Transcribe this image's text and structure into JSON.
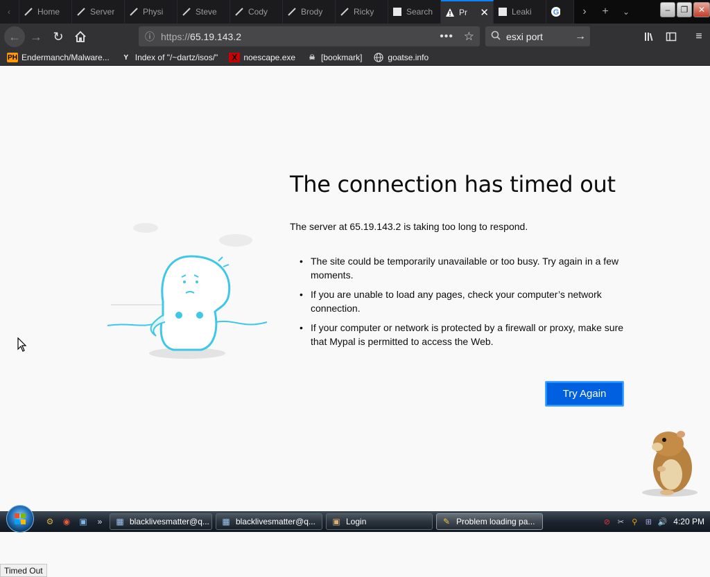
{
  "tabs": [
    {
      "title": "",
      "icon": "nav-back-icon"
    },
    {
      "title": "Home",
      "icon": "pencil-icon"
    },
    {
      "title": "Server",
      "icon": "pencil-icon"
    },
    {
      "title": "Physi",
      "icon": "pencil-icon"
    },
    {
      "title": "Steve",
      "icon": "pencil-icon"
    },
    {
      "title": "Cody",
      "icon": "pencil-icon"
    },
    {
      "title": "Brody",
      "icon": "pencil-icon"
    },
    {
      "title": "Ricky",
      "icon": "pencil-icon"
    },
    {
      "title": "Search",
      "icon": "doc-icon"
    },
    {
      "title": "Pr",
      "icon": "warning-icon",
      "active": true
    },
    {
      "title": "Leaki",
      "icon": "doc-icon"
    },
    {
      "title": "",
      "icon": "google-icon"
    }
  ],
  "nav": {
    "url_protocol": "https://",
    "url_host": "65.19.143.2",
    "search_value": "esxi port"
  },
  "bookmarks": [
    {
      "label": "Endermanch/Malware...",
      "icon": "PH"
    },
    {
      "label": "Index of \"/~dartz/isos/\"",
      "icon": "Y"
    },
    {
      "label": "noescape.exe",
      "icon": "X"
    },
    {
      "label": "[bookmark]",
      "icon": "skull"
    },
    {
      "label": "goatse.info",
      "icon": "globe"
    }
  ],
  "error": {
    "title": "The connection has timed out",
    "description": "The server at 65.19.143.2 is taking too long to respond.",
    "bullets": [
      "The site could be temporarily unavailable or too busy. Try again in a few moments.",
      "If you are unable to load any pages, check your computer’s network connection.",
      "If your computer or network is protected by a firewall or proxy, make sure that Mypal is permitted to access the Web."
    ],
    "button": "Try Again"
  },
  "status_tooltip": "Timed Out",
  "taskbar": {
    "buttons": [
      {
        "label": "blacklivesmatter@q..."
      },
      {
        "label": "blacklivesmatter@q..."
      },
      {
        "label": "Login"
      },
      {
        "label": "Problem loading pa...",
        "active": true
      }
    ],
    "clock": "4:20 PM"
  },
  "colors": {
    "accent": "#0060df",
    "chrome_dark": "#323234",
    "page_bg": "#f9f9fa",
    "illustration": "#3fc7e8"
  }
}
